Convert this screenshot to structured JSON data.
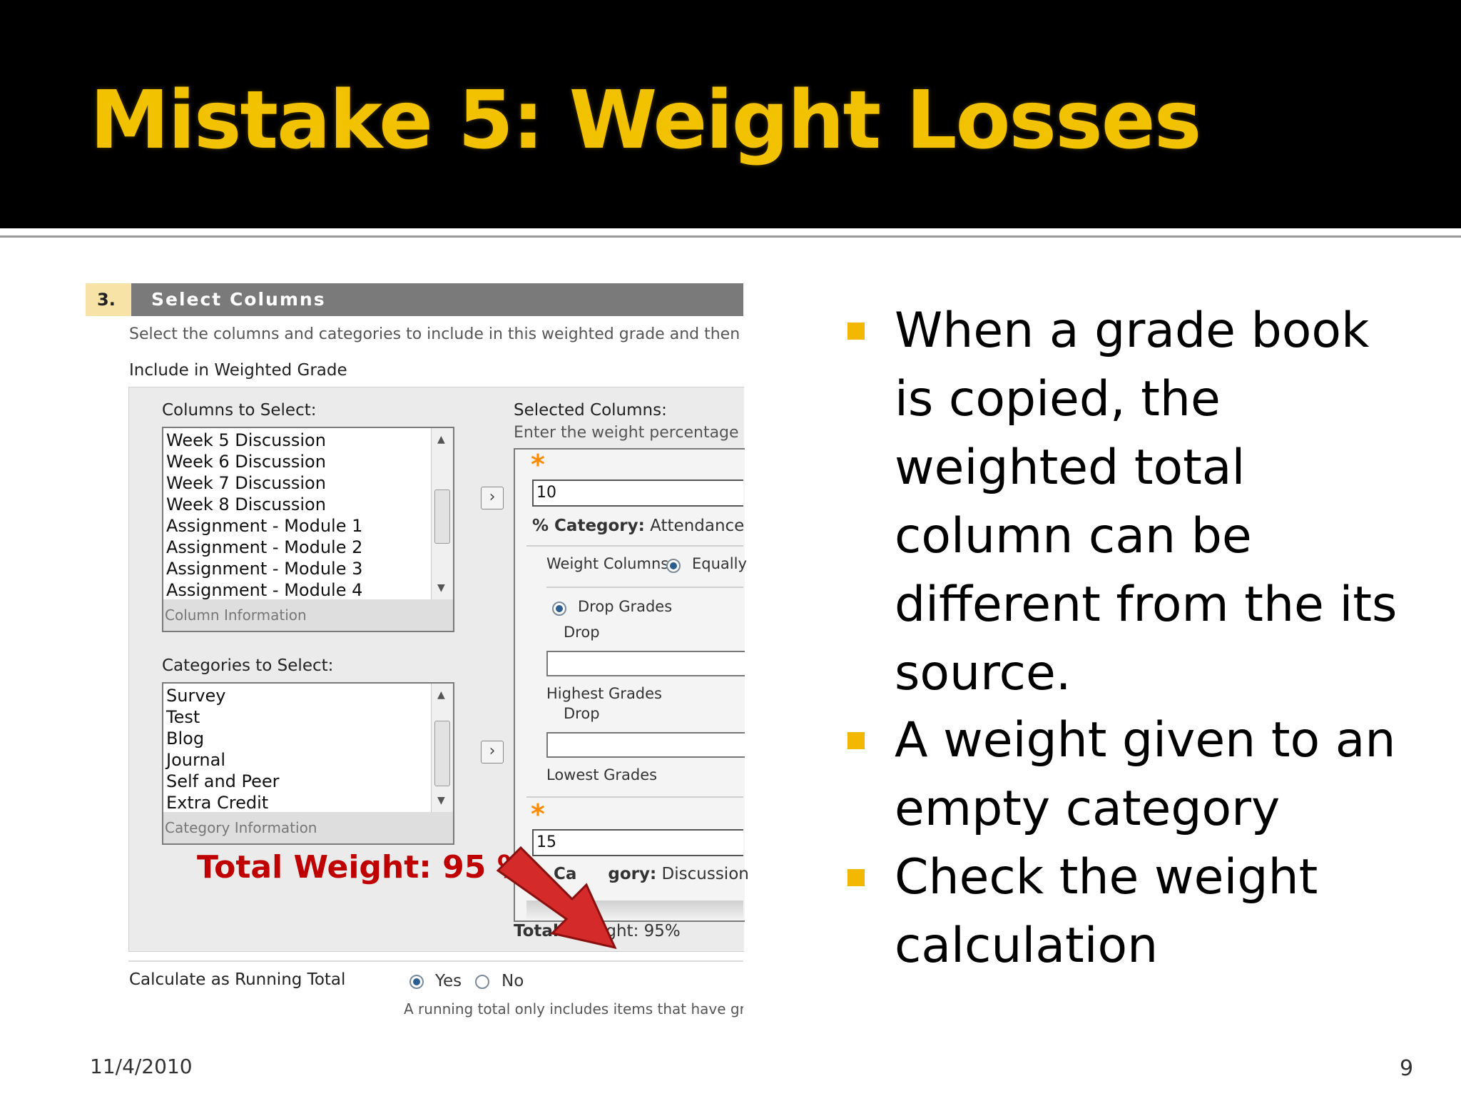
{
  "slide": {
    "title": "Mistake 5: Weight Losses",
    "date": "11/4/2010",
    "page_number": "9",
    "colors": {
      "title": "#f2c200",
      "title_bar": "#000000",
      "bullet": "#f2b800",
      "callout": "#c00000",
      "arrow": "#d42a2a"
    }
  },
  "screenshot": {
    "step_number": "3.",
    "step_title": "Select Columns",
    "instructions": "Select the columns and categories to include in this weighted grade and then s",
    "include_label": "Include in Weighted Grade",
    "columns_label": "Columns to Select:",
    "columns": [
      "Week 5 Discussion",
      "Week 6 Discussion",
      "Week 7 Discussion",
      "Week 8 Discussion",
      "Assignment - Module 1",
      "Assignment - Module 2",
      "Assignment - Module 3",
      "Assignment - Module 4"
    ],
    "column_info": "Column Information",
    "categories_label": "Categories to Select:",
    "categories": [
      "Survey",
      "Test",
      "Blog",
      "Journal",
      "Self and Peer",
      "Extra Credit"
    ],
    "category_info": "Category Information",
    "selected_label": "Selected Columns:",
    "selected_hint": "Enter the weight percentage f",
    "item1": {
      "weight": "10",
      "category_prefix": "% Category:",
      "category_name": "Attendance",
      "weight_columns_label": "Weight Columns:",
      "equally_label": "Equally",
      "drop_grades_label": "Drop Grades",
      "drop_label_1": "Drop",
      "highest_grades_label": "Highest Grades",
      "drop_label_2": "Drop",
      "lowest_grades_label": "Lowest Grades"
    },
    "item2": {
      "weight": "15",
      "category_prefix": "Ca",
      "category_prefix_2": "gory:",
      "category_name": "Discussion"
    },
    "total_weight_small_a": "Total",
    "total_weight_small_b": "eight: 95%",
    "total_weight_callout": "Total Weight: 95 %",
    "running_total_label": "Calculate as Running Total",
    "yes_label": "Yes",
    "no_label": "No",
    "running_total_hint": "A running total only includes items that have grad"
  },
  "bullets": [
    "When a grade book is  copied, the weighted total column can be different from the its source.",
    "A weight given to an empty category",
    "Check the weight calculation"
  ]
}
